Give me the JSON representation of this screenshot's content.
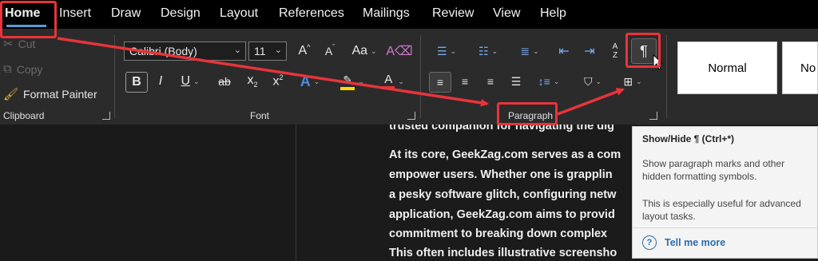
{
  "menu": {
    "tabs": [
      "Home",
      "Insert",
      "Draw",
      "Design",
      "Layout",
      "References",
      "Mailings",
      "Review",
      "View",
      "Help"
    ]
  },
  "clipboard": {
    "cut": "Cut",
    "copy": "Copy",
    "format_painter": "Format Painter",
    "label": "Clipboard"
  },
  "font": {
    "family": "Calibri (Body)",
    "size": "11",
    "grow": "A",
    "shrink": "A",
    "change_case": "Aa",
    "bold": "B",
    "italic": "I",
    "underline": "U",
    "strikethrough": "ab",
    "subscript": "x",
    "subscript_mark": "2",
    "superscript": "x",
    "superscript_mark": "2",
    "text_effects": "A",
    "font_color": "A",
    "label": "Font",
    "highlight_color": "#ffd800",
    "font_color_bar": "#e8343b"
  },
  "paragraph": {
    "sort": "A Z",
    "pilcrow": "¶",
    "label": "Paragraph"
  },
  "styles": {
    "normal": "Normal",
    "next": "No"
  },
  "document": {
    "lines": [
      "trusted companion for navigating the dig",
      "At its core, GeekZag.com serves as a com",
      "empower users. Whether one is grapplin",
      "a pesky software glitch, configuring netw",
      "application, GeekZag.com aims to provid",
      "commitment to breaking down complex",
      "This often includes illustrative screensho"
    ]
  },
  "tooltip": {
    "title": "Show/Hide ¶ (Ctrl+*)",
    "body1": "Show paragraph marks and other hidden formatting symbols.",
    "body2": "This is especially useful for advanced layout tasks.",
    "link": "Tell me more",
    "help_glyph": "?"
  },
  "colors": {
    "annotation": "#e8343b",
    "accent": "#5b9bd5"
  }
}
